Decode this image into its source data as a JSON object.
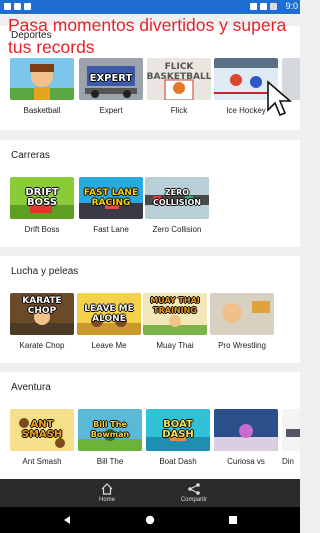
{
  "status_bar": {
    "time": "9:0",
    "background": "#1f6fd1"
  },
  "promo_text": "Pasa momentos divertidos y supera tus records",
  "promo_color": "#e8202a",
  "sections": [
    {
      "title": "Deportes",
      "games": [
        {
          "label": "Basketball",
          "art": ""
        },
        {
          "label": "Expert",
          "art": "EXPERT"
        },
        {
          "label": "Flick",
          "art": "FLICK BASKETBALL"
        },
        {
          "label": "Ice Hockey",
          "art": ""
        }
      ]
    },
    {
      "title": "Carreras",
      "games": [
        {
          "label": "Drift Boss",
          "art": "DRIFT BOSS"
        },
        {
          "label": "Fast Lane",
          "art": "FAST LANE RACING"
        },
        {
          "label": "Zero Collision",
          "art": "ZERO COLLISION"
        }
      ]
    },
    {
      "title": "Lucha y peleas",
      "games": [
        {
          "label": "Karate Chop",
          "art": "KARATE CHOP"
        },
        {
          "label": "Leave Me",
          "art": "LEAVE ME ALONE"
        },
        {
          "label": "Muay Thai",
          "art": "MUAY THAI TRAINING"
        },
        {
          "label": "Pro Wrestling",
          "art": ""
        }
      ]
    },
    {
      "title": "Aventura",
      "games": [
        {
          "label": "Ant Smash",
          "art": "ANT SMASH"
        },
        {
          "label": "Bill The",
          "art": "Bill The Bowman"
        },
        {
          "label": "Boat Dash",
          "art": "BOAT DASH"
        },
        {
          "label": "Curiosa vs",
          "art": ""
        },
        {
          "label": "Din",
          "art": ""
        }
      ]
    }
  ],
  "bottom_nav": [
    {
      "label": "Home",
      "icon": "home-icon"
    },
    {
      "label": "Compartir",
      "icon": "share-icon"
    }
  ],
  "system_nav": [
    {
      "icon": "back-icon"
    },
    {
      "icon": "home-circle-icon"
    },
    {
      "icon": "recents-icon"
    }
  ]
}
